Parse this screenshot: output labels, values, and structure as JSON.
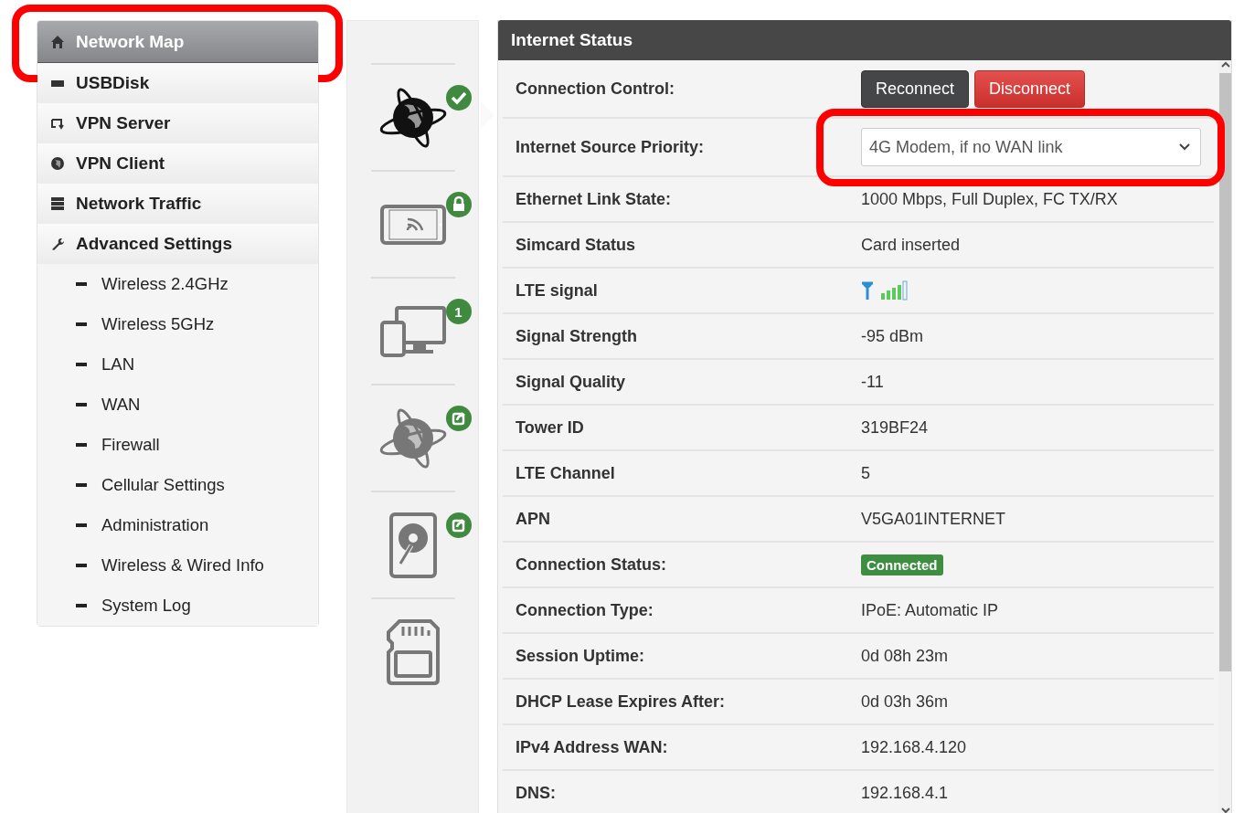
{
  "sidebar": {
    "items": [
      {
        "label": "Network Map",
        "kind": "home",
        "selected": true,
        "highlighted": true
      },
      {
        "label": "USBDisk",
        "kind": "disk",
        "selected": false,
        "highlighted": false
      },
      {
        "label": "VPN Server",
        "kind": "swap",
        "selected": false,
        "highlighted": false
      },
      {
        "label": "VPN Client",
        "kind": "globe",
        "selected": false,
        "highlighted": false
      },
      {
        "label": "Network Traffic",
        "kind": "server",
        "selected": false,
        "highlighted": false
      },
      {
        "label": "Advanced Settings",
        "kind": "wrench",
        "selected": false,
        "highlighted": false
      },
      {
        "label": "Wireless 2.4GHz",
        "kind": "sub",
        "selected": false,
        "highlighted": false
      },
      {
        "label": "Wireless 5GHz",
        "kind": "sub",
        "selected": false,
        "highlighted": false
      },
      {
        "label": "LAN",
        "kind": "sub",
        "selected": false,
        "highlighted": false
      },
      {
        "label": "WAN",
        "kind": "sub",
        "selected": false,
        "highlighted": false
      },
      {
        "label": "Firewall",
        "kind": "sub",
        "selected": false,
        "highlighted": false
      },
      {
        "label": "Cellular Settings",
        "kind": "sub",
        "selected": false,
        "highlighted": false
      },
      {
        "label": "Administration",
        "kind": "sub",
        "selected": false,
        "highlighted": false
      },
      {
        "label": "Wireless & Wired Info",
        "kind": "sub",
        "selected": false,
        "highlighted": false
      },
      {
        "label": "System Log",
        "kind": "sub",
        "selected": false,
        "highlighted": false
      }
    ]
  },
  "devices": [
    {
      "kind": "globe",
      "selected": true
    },
    {
      "kind": "tablet",
      "selected": false
    },
    {
      "kind": "screens",
      "selected": false,
      "count": "1"
    },
    {
      "kind": "globe",
      "selected": false
    },
    {
      "kind": "harddisk",
      "selected": false
    },
    {
      "kind": "sdcard",
      "selected": false
    }
  ],
  "panel": {
    "title": "Internet Status",
    "rows": [
      {
        "kind": "buttons",
        "label": "Connection Control:",
        "buttons": [
          {
            "label": "Reconnect",
            "kind": "dark"
          },
          {
            "label": "Disconnect",
            "kind": "danger"
          }
        ]
      },
      {
        "kind": "select",
        "label": "Internet Source Priority:",
        "value": "4G Modem, if no WAN link",
        "highlighted": true
      },
      {
        "kind": "text",
        "label": "Ethernet Link State:",
        "value": "1000 Mbps, Full Duplex, FC TX/RX"
      },
      {
        "kind": "text",
        "label": "Simcard Status",
        "value": "Card inserted"
      },
      {
        "kind": "signal",
        "label": "LTE signal"
      },
      {
        "kind": "text",
        "label": "Signal Strength",
        "value": "-95 dBm"
      },
      {
        "kind": "text",
        "label": "Signal Quality",
        "value": "-11"
      },
      {
        "kind": "text",
        "label": "Tower ID",
        "value": "319BF24"
      },
      {
        "kind": "text",
        "label": "LTE Channel",
        "value": "5"
      },
      {
        "kind": "text",
        "label": "APN",
        "value": "V5GA01INTERNET"
      },
      {
        "kind": "badge",
        "label": "Connection Status:",
        "value": "Connected"
      },
      {
        "kind": "text",
        "label": "Connection Type:",
        "value": "IPoE: Automatic IP"
      },
      {
        "kind": "text",
        "label": "Session Uptime:",
        "value": "0d 08h 23m"
      },
      {
        "kind": "text",
        "label": "DHCP Lease Expires After:",
        "value": "0d 03h 36m"
      },
      {
        "kind": "text",
        "label": "IPv4 Address WAN:",
        "value": "192.168.4.120"
      },
      {
        "kind": "text",
        "label": "DNS:",
        "value": "192.168.4.1"
      }
    ]
  }
}
